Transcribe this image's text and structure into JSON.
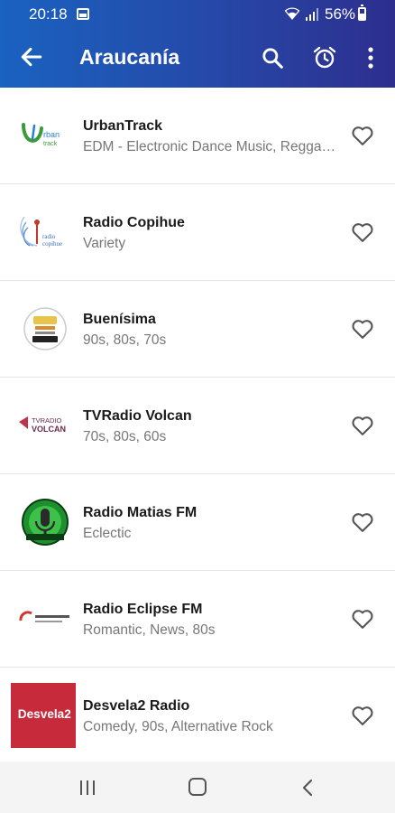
{
  "status_bar": {
    "time": "20:18",
    "battery": "56%"
  },
  "app_bar": {
    "title": "Araucanía",
    "back_icon": "arrow-left-icon",
    "search_icon": "search-icon",
    "alarm_icon": "alarm-clock-icon",
    "more_icon": "more-vert-icon"
  },
  "stations": [
    {
      "name": "UrbanTrack",
      "genre": "EDM - Electronic Dance Music, Reggaeton",
      "logo": "urbantrack-logo"
    },
    {
      "name": "Radio Copihue",
      "genre": "Variety",
      "logo": "radio-copihue-logo"
    },
    {
      "name": "Buenísima",
      "genre": " 90s, 80s, 70s",
      "logo": "buenisima-logo"
    },
    {
      "name": "TVRadio Volcan",
      "genre": "70s, 80s, 60s",
      "logo": "tvradio-volcan-logo",
      "logo_text_top": "TVRADIO",
      "logo_text_bottom": "VOLCAN"
    },
    {
      "name": "Radio Matias FM",
      "genre": " Eclectic",
      "logo": "radio-matias-fm-logo"
    },
    {
      "name": "Radio Eclipse FM",
      "genre": "Romantic, News, 80s",
      "logo": "radio-eclipse-fm-logo"
    },
    {
      "name": "Desvela2 Radio",
      "genre": "Comedy, 90s, Alternative Rock",
      "logo": "desvela2-radio-logo",
      "logo_text": "Desvela2"
    }
  ],
  "colors": {
    "app_bar_start": "#1a62c0",
    "app_bar_end": "#2d2e8e",
    "heart": "#555555"
  }
}
